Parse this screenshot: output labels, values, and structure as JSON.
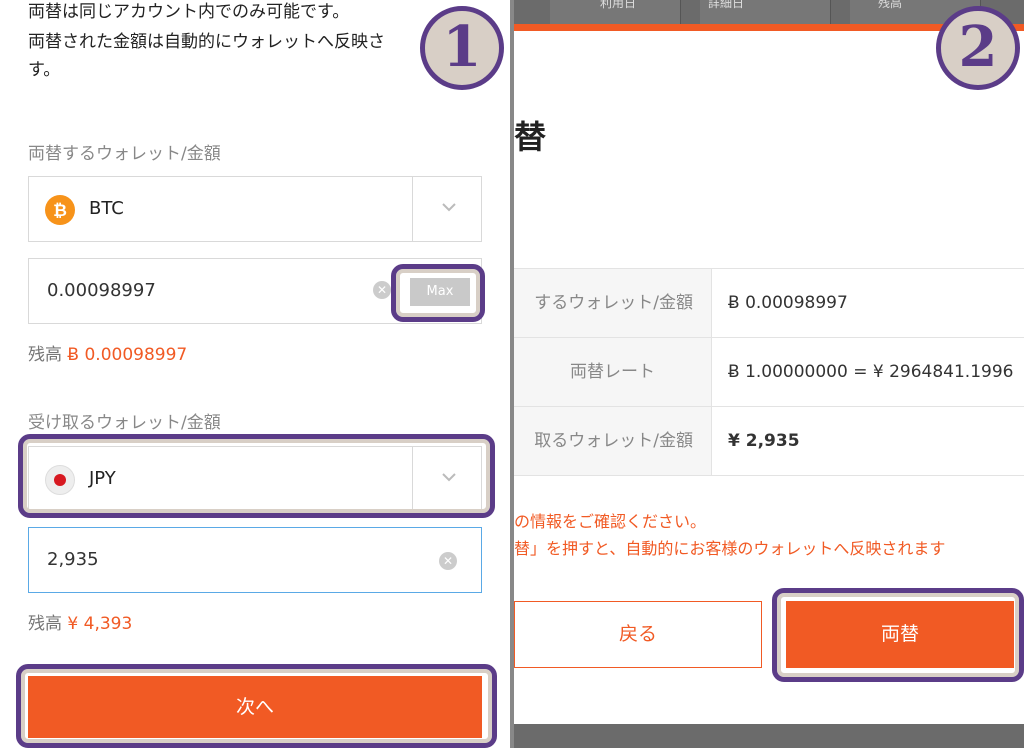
{
  "left": {
    "notice_line1": "両替は同じアカウント内でのみ可能です。",
    "notice_line2": "両替された金額は自動的にウォレットへ反映さ",
    "notice_line3": "す。",
    "from_label": "両替するウォレット/金額",
    "from_currency": "BTC",
    "from_currency_icon": "bitcoin-icon",
    "from_amount": "0.00098997",
    "max_label": "Max",
    "from_balance_prefix": "残高",
    "from_balance": "Ƀ 0.00098997",
    "to_label": "受け取るウォレット/金額",
    "to_currency": "JPY",
    "to_currency_icon": "japan-flag-icon",
    "to_amount": "2,935",
    "to_balance_prefix": "残高",
    "to_balance": "¥ 4,393",
    "next_label": "次へ",
    "badge": "1"
  },
  "right": {
    "top_tabs": [
      "利用日",
      "詳細日",
      "残高"
    ],
    "title": "替",
    "rows": [
      {
        "key": "するウォレット/金額",
        "value": "Ƀ 0.00098997",
        "bold": false
      },
      {
        "key": "両替レート",
        "value": "Ƀ 1.00000000 = ¥ 2964841.1996",
        "bold": false
      },
      {
        "key": "取るウォレット/金額",
        "value": "¥ 2,935",
        "bold": true
      }
    ],
    "warning_line1": "の情報をご確認ください。",
    "warning_line2": "替」を押すと、自動的にお客様のウォレットへ反映されます",
    "back_label": "戻る",
    "exchange_label": "両替",
    "badge": "2"
  },
  "colors": {
    "accent": "#f15a24",
    "highlight": "#5b3c88",
    "highlight_fill": "#d8cfc6"
  }
}
